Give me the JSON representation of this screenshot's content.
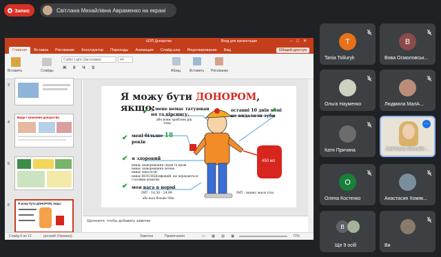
{
  "meet": {
    "record_label": "Запис",
    "presenting_text": "Світлана Михайлівна Авраменко на екрані"
  },
  "powerpoint": {
    "window_title": "ШЗП Донорство",
    "user_prompt": "Вход для презентации",
    "tabs": [
      "Главная",
      "Вставка",
      "Рисование",
      "Конструктор",
      "Переходы",
      "Анимация",
      "Слайд-шоу",
      "Рецензирование",
      "Вид"
    ],
    "share_label": "Общий доступ",
    "ribbon": {
      "paste": "Вставить",
      "slides": "Слайды",
      "font_name": "Calibri Light (Заголовки)",
      "font_size": "44",
      "paragraph": "Абзац",
      "insert": "Вставить",
      "drawing": "Рисование"
    },
    "thumbnail_numbers": [
      "3",
      "4",
      "5",
      "6"
    ],
    "thumb4_title": "Види і значення донорства",
    "thumb6_title": "Я можу бути ДОНОРОМ, якщо:",
    "notes_placeholder": "Щелкните, чтобы добавить заметки",
    "status": {
      "slide_info": "Слайд 6 из 12",
      "language": "русский (Украина)",
      "notes": "Заметки",
      "comments": "Примечания",
      "zoom": "71%"
    },
    "slide": {
      "title_prefix": "Я можу бути ",
      "title_highlight": "ДОНОРОМ",
      "title_suffix": ", якщо:",
      "item_tattoo_1": "у мене немає татуюван",
      "item_tattoo_2": "ня та пірсингу.",
      "item_tattoo_note": "або вони зроблені рік",
      "item_tattoo_note2": "тому",
      "item_teeth_1": "останні 10 днів мені",
      "item_teeth_2": "не видаляли зуби",
      "item_age_1": "мені більше ",
      "item_age_num": "18",
      "item_age_2": "років",
      "item_healthy": "я здоровий",
      "healthy_details": [
        "немає захворювання серця та крові",
        "немає захворювання легень",
        "немає онкологій",
        "немає ВІЛ/СНІД(інфекцій, що передаються",
        "статевим шляхом)"
      ],
      "item_weight": "моя вага в нормі",
      "bmi": "ІМТ - 18.50 - 24.99",
      "weight_note": "або вага більше 50кг",
      "bmi_right": "ІМТ - індекс маси тіла",
      "blood_bag": "450 мл"
    }
  },
  "participants": [
    {
      "name": "Tania Tsiliuryk",
      "initial": "T",
      "color": "#e8711a"
    },
    {
      "name": "Вова Осмоловськ...",
      "initial": "В",
      "color": "#8d4a4a"
    },
    {
      "name": "Ольга Науменко",
      "initial": "",
      "color": "#9aa0a6"
    },
    {
      "name": "Людмила МалА...",
      "initial": "",
      "color": "#b98d7a"
    },
    {
      "name": "Катя Причина",
      "initial": "",
      "color": "#6c6c6c"
    },
    {
      "name": "Світлана Михайл...",
      "initial": "",
      "color": "#e7d3b8"
    },
    {
      "name": "Олена Костенко",
      "initial": "О",
      "color": "#188038"
    },
    {
      "name": "Анастасия Хомяк...",
      "initial": "",
      "color": "#7a8f9c"
    },
    {
      "name": "Ще 9 осіб",
      "initial": "В",
      "color": "#5f6368"
    },
    {
      "name": "Ви",
      "initial": "",
      "color": "#8a7a6a"
    }
  ]
}
